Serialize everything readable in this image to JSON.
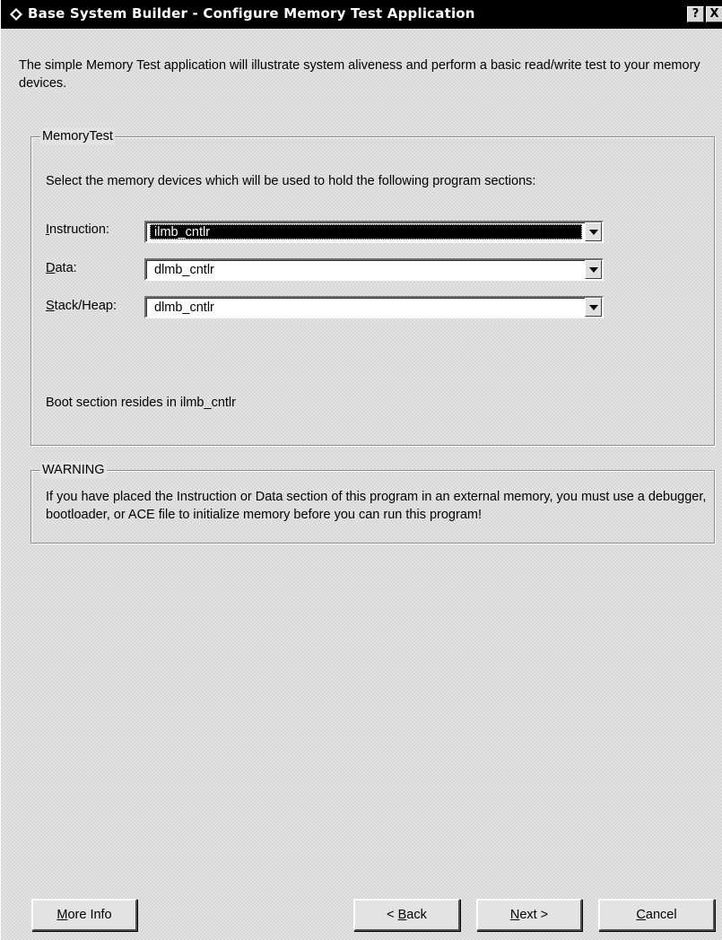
{
  "window": {
    "title": "Base System Builder - Configure Memory Test Application",
    "help_label": "?",
    "close_label": "X"
  },
  "intro_text": "The simple Memory Test application will illustrate system aliveness and perform a basic read/write test to your memory devices.",
  "memory_group": {
    "legend": "MemoryTest",
    "description": "Select the memory devices which will be used to hold the following program sections:",
    "fields": [
      {
        "label_accel": "I",
        "label_rest": "nstruction:",
        "value": "ilmb_cntlr",
        "selected": true
      },
      {
        "label_accel": "D",
        "label_rest": "ata:",
        "value": "dlmb_cntlr",
        "selected": false
      },
      {
        "label_accel": "S",
        "label_rest": "tack/Heap:",
        "value": "dlmb_cntlr",
        "selected": false
      }
    ],
    "boot_text": "Boot section resides in ilmb_cntlr"
  },
  "warning_group": {
    "legend": "WARNING",
    "text": "If you have placed the Instruction or Data section of this program in an external memory, you must use a debugger, bootloader, or ACE file to initialize memory before you can run this program!"
  },
  "buttons": {
    "more_info_accel": "M",
    "more_info_rest": "ore Info",
    "back_prefix": "< ",
    "back_accel": "B",
    "back_rest": "ack",
    "next_accel": "N",
    "next_rest": "ext >",
    "cancel_accel": "C",
    "cancel_rest": "ancel"
  }
}
